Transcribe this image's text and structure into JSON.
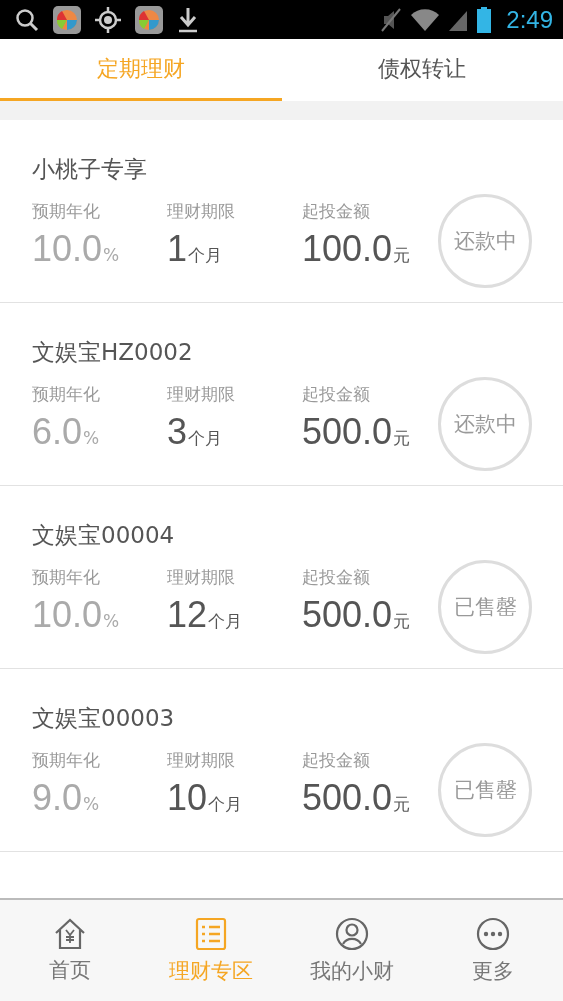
{
  "status_bar": {
    "time": "2:49"
  },
  "tabs": [
    {
      "label": "定期理财",
      "selected": true
    },
    {
      "label": "债权转让",
      "selected": false
    }
  ],
  "products": [
    {
      "name": "小桃子专享",
      "rate_label": "预期年化",
      "rate": "10.0",
      "rate_unit": "%",
      "term_label": "理财期限",
      "term": "1",
      "term_unit": "个月",
      "amount_label": "起投金额",
      "amount": "100.0",
      "amount_unit": "元",
      "status": "还款中"
    },
    {
      "name": "文娱宝HZ0002",
      "rate_label": "预期年化",
      "rate": "6.0",
      "rate_unit": "%",
      "term_label": "理财期限",
      "term": "3",
      "term_unit": "个月",
      "amount_label": "起投金额",
      "amount": "500.0",
      "amount_unit": "元",
      "status": "还款中"
    },
    {
      "name": "文娱宝00004",
      "rate_label": "预期年化",
      "rate": "10.0",
      "rate_unit": "%",
      "term_label": "理财期限",
      "term": "12",
      "term_unit": "个月",
      "amount_label": "起投金额",
      "amount": "500.0",
      "amount_unit": "元",
      "status": "已售罄"
    },
    {
      "name": "文娱宝00003",
      "rate_label": "预期年化",
      "rate": "9.0",
      "rate_unit": "%",
      "term_label": "理财期限",
      "term": "10",
      "term_unit": "个月",
      "amount_label": "起投金额",
      "amount": "500.0",
      "amount_unit": "元",
      "status": "已售罄"
    }
  ],
  "nav": [
    {
      "kind": "home",
      "label": "首页",
      "selected": false
    },
    {
      "kind": "list",
      "label": "理财专区",
      "selected": true
    },
    {
      "kind": "user",
      "label": "我的小财",
      "selected": false
    },
    {
      "kind": "more",
      "label": "更多",
      "selected": false
    }
  ]
}
